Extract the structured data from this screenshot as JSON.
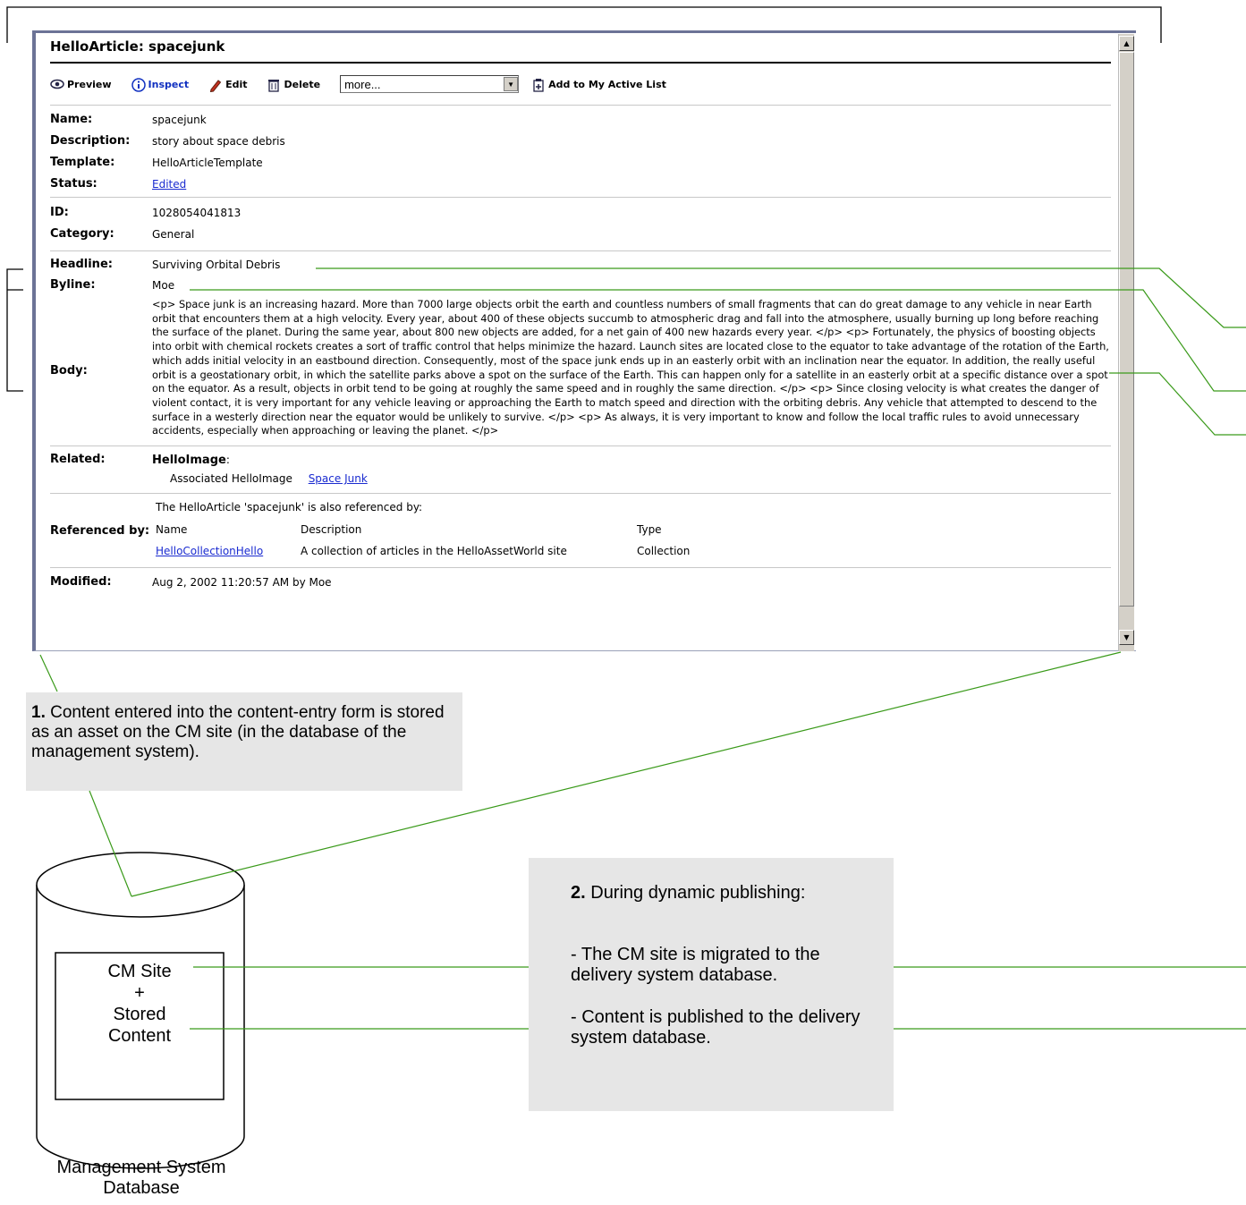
{
  "window": {
    "title": "HelloArticle: spacejunk",
    "toolbar": {
      "preview": "Preview",
      "inspect": "Inspect",
      "edit": "Edit",
      "delete": "Delete",
      "more_select": "more...",
      "add_active": "Add to My Active List"
    },
    "fields": {
      "name_label": "Name:",
      "name_value": "spacejunk",
      "description_label": "Description:",
      "description_value": "story about space debris",
      "template_label": "Template:",
      "template_value": "HelloArticleTemplate",
      "status_label": "Status:",
      "status_value": "Edited",
      "id_label": "ID:",
      "id_value": "1028054041813",
      "category_label": "Category:",
      "category_value": "General",
      "headline_label": "Headline:",
      "headline_value": "Surviving Orbital Debris",
      "byline_label": "Byline:",
      "byline_value": "Moe",
      "body_label": "Body:",
      "body_value": "<p> Space junk is an increasing hazard. More than 7000 large objects orbit the earth and countless numbers of small fragments that can do great damage to any vehicle in near Earth orbit that encounters them at a high velocity. Every year, about 400 of these objects succumb to atmospheric drag and fall into the atmosphere, usually burning up long before reaching the surface of the planet. During the same year, about 800 new objects are added, for a net gain of 400 new hazards every year. </p> <p> Fortunately, the physics of boosting objects into orbit with chemical rockets creates a sort of traffic control that helps minimize the hazard. Launch sites are located close to the equator to take advantage of the rotation of the Earth, which adds initial velocity in an eastbound direction. Consequently, most of the space junk ends up in an easterly orbit with an inclination near the equator. In addition, the really useful orbit is a geostationary orbit, in which the satellite parks above a spot on the surface of the Earth. This can happen only for a satellite in an easterly orbit at a specific distance over a spot on the equator. As a result, objects in orbit tend to be going at roughly the same speed and in roughly the same direction. </p> <p> Since closing velocity is what creates the danger of violent contact, it is very important for any vehicle leaving or approaching the Earth to match speed and direction with the orbiting debris. Any vehicle that attempted to descend to the surface in a westerly direction near the equator would be unlikely to survive. </p> <p> As always, it is very important to know and follow the local traffic rules to avoid unnecessary accidents, especially when approaching or leaving the planet. </p>",
      "related_label": "Related:",
      "related_type": "HelloImage",
      "related_type_colon": ":",
      "related_assoc": "Associated HelloImage",
      "related_link": "Space Junk",
      "referenced_label": "Referenced by:",
      "referenced_intro": "The HelloArticle 'spacejunk' is also referenced by:",
      "ref_headers": [
        "Name",
        "Description",
        "Type"
      ],
      "ref_rows": [
        [
          "HelloCollectionHello",
          "A collection of articles in the HelloAssetWorld site",
          "Collection"
        ]
      ],
      "modified_label": "Modified:",
      "modified_value": "Aug 2, 2002 11:20:57 AM by Moe"
    }
  },
  "callout1": {
    "number": "1.",
    "text": " Content entered into the content-entry form is stored as an asset on the CM site (in the database of the management system)."
  },
  "callout2": {
    "number": "2.",
    "heading": " During dynamic publishing:",
    "item1": "- The CM site is migrated to the delivery system database.",
    "item2": "- Content is published to the delivery system database."
  },
  "database": {
    "box_line1": "CM Site",
    "box_line2": "+",
    "box_line3": "Stored",
    "box_line4": "Content",
    "label_line1": "Management System",
    "label_line2": "Database"
  },
  "colors": {
    "leader_line": "#3a9a1a",
    "callout_bg": "#e6e6e6",
    "window_border": "#6c7396",
    "link": "#1a2bd0"
  }
}
